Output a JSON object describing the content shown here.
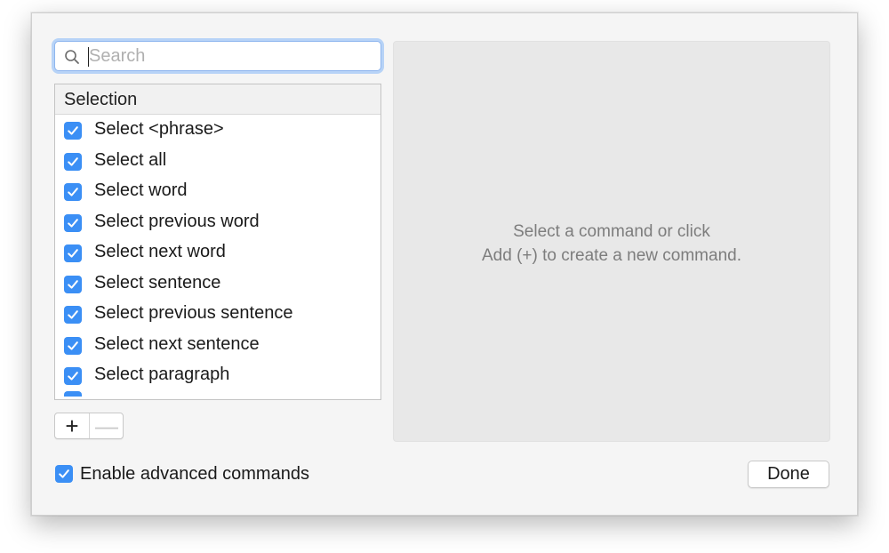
{
  "search": {
    "placeholder": "Search",
    "value": ""
  },
  "list": {
    "header": "Selection",
    "items": [
      {
        "label": "Select <phrase>",
        "checked": true
      },
      {
        "label": "Select all",
        "checked": true
      },
      {
        "label": "Select word",
        "checked": true
      },
      {
        "label": "Select previous word",
        "checked": true
      },
      {
        "label": "Select next word",
        "checked": true
      },
      {
        "label": "Select sentence",
        "checked": true
      },
      {
        "label": "Select previous sentence",
        "checked": true
      },
      {
        "label": "Select next sentence",
        "checked": true
      },
      {
        "label": "Select paragraph",
        "checked": true
      }
    ]
  },
  "controls": {
    "add_label": "+",
    "remove_label": "—"
  },
  "detail": {
    "line1": "Select a command or click",
    "line2": "Add (+) to create a new command."
  },
  "footer": {
    "advanced_label": "Enable advanced commands",
    "advanced_checked": true,
    "done_label": "Done"
  },
  "colors": {
    "accent": "#3b8ff5",
    "panel_bg": "#e8e8e8",
    "dialog_bg": "#f5f5f5",
    "focus_ring": "#b7d3f7"
  },
  "icons": {
    "search": "magnifier-icon",
    "check": "checkmark-icon"
  }
}
